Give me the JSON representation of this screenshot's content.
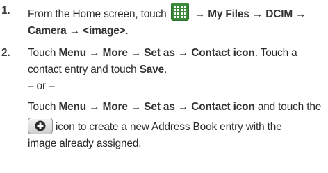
{
  "steps": [
    {
      "number": "1.",
      "line1_pre": "From the Home screen, touch",
      "line1_arrow": "→",
      "line1_b1": "My Files",
      "line1_arrow2": "→",
      "line1_b2": "DCIM",
      "line1_arrow3": "→",
      "line2_b1": "Camera",
      "line2_arrow": "→",
      "line2_b2": "<image>",
      "line2_end": ".",
      "icon": "apps-grid-icon"
    },
    {
      "number": "2.",
      "a_touch": "Touch",
      "a_menu": "Menu",
      "a_arrow1": "→",
      "a_more": "More",
      "a_arrow2": "→",
      "a_setas": "Set as",
      "a_arrow3": "→",
      "a_contact": "Contact icon",
      "a_rest": ". Touch a",
      "b_text": "contact entry and touch",
      "b_save": "Save",
      "b_end": ".",
      "or": "– or –",
      "c_touch": "Touch",
      "c_menu": "Menu",
      "c_arrow1": "→",
      "c_more": "More",
      "c_arrow2": "→",
      "c_setas": "Set as",
      "c_arrow3": "→",
      "c_contact": "Contact icon",
      "c_rest": "and touch the",
      "d_rest": "icon to create a new Address Book entry with the",
      "e_text": "image already assigned.",
      "icon": "add-contact-icon"
    }
  ]
}
